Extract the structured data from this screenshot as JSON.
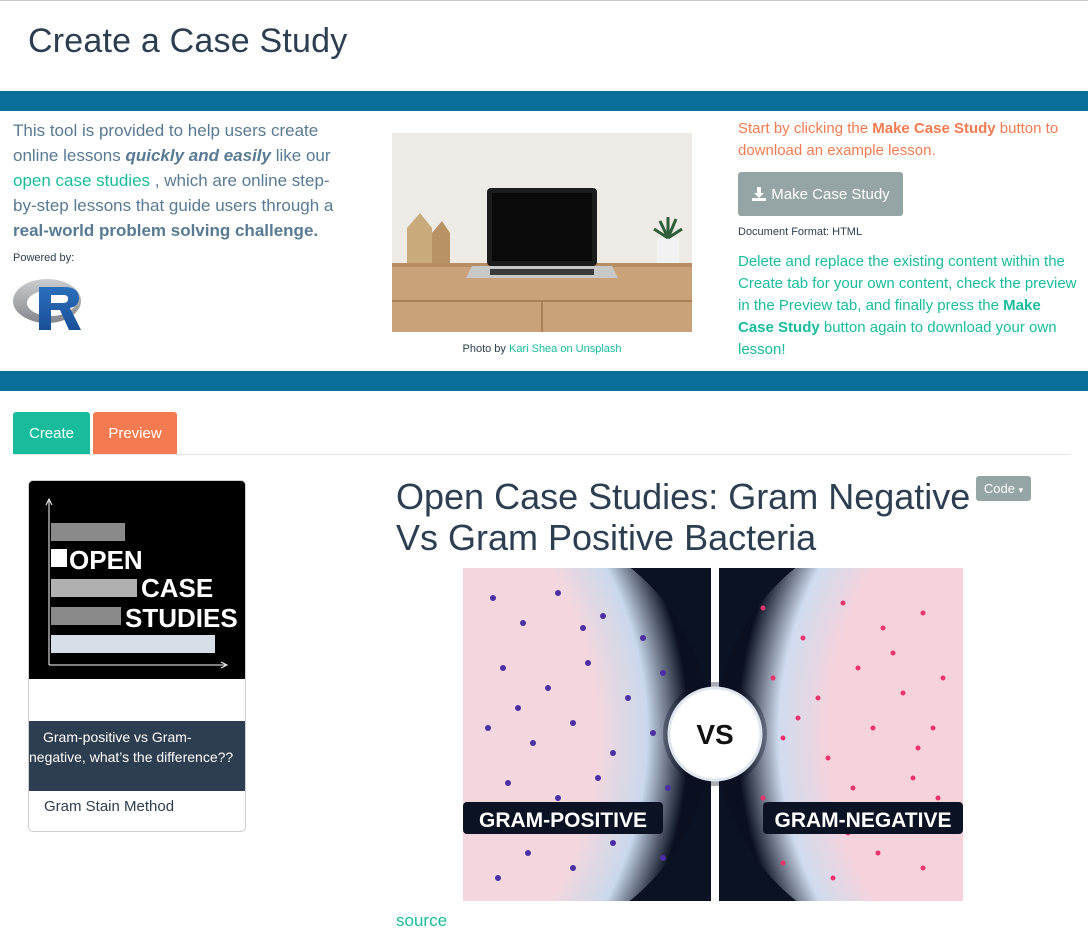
{
  "page": {
    "title": "Create a Case Study"
  },
  "intro": {
    "left": {
      "p1": "This tool is provided to help users create online lessons ",
      "em": "quickly and easily",
      "p2": " like our ",
      "link": "open case studies",
      "p3": " , which are online step-by-step lessons that guide users through a ",
      "strong": "real-world problem solving challenge.",
      "powered_by": "Powered by:",
      "logo_text": "R"
    },
    "photo": {
      "caption_prefix": "Photo by ",
      "caption_link": "Kari Shea on Unsplash"
    },
    "right": {
      "start_p1": "Start by clicking the ",
      "start_b": "Make Case Study",
      "start_p2": " button to download an example lesson.",
      "button_label": "Make Case Study",
      "button_icon": "download-icon",
      "doc_format": "Document Format: HTML",
      "del_p1": "Delete and replace the existing content within the Create tab for your own content, check the preview in the Preview tab, and finally press the ",
      "del_b": "Make Case Study",
      "del_p2": " button again to download your own lesson!"
    }
  },
  "tabs": [
    {
      "label": "Create"
    },
    {
      "label": "Preview"
    }
  ],
  "card": {
    "logo_lines": [
      "OPEN",
      "CASE",
      "STUDIES"
    ],
    "caption": "Gram-positive vs Gram-negative, what’s the difference??",
    "footer": "Gram Stain Method"
  },
  "preview": {
    "title": "Open Case Studies: Gram Negative Vs Gram Positive Bacteria",
    "code_button": "Code",
    "image": {
      "left_label": "GRAM-POSITIVE",
      "right_label": "GRAM-NEGATIVE",
      "vs_label": "VS"
    },
    "source_link": "source"
  },
  "colors": {
    "band": "#0a6e99",
    "accent_green": "#18bc9c",
    "accent_orange": "#f47b51",
    "dark_navy": "#2c3e50",
    "grey_button": "#95a5a6"
  }
}
